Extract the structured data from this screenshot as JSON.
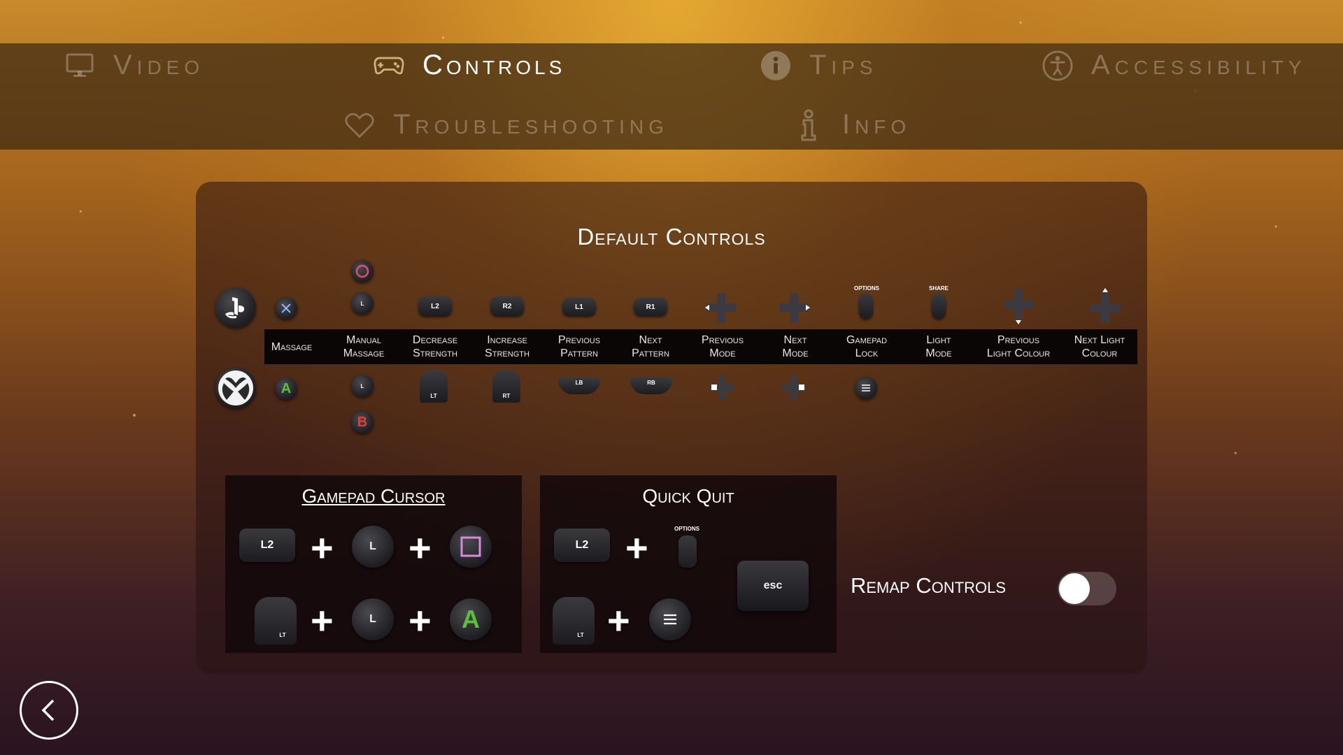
{
  "tabs": [
    {
      "label": "Video",
      "icon": "monitor-icon",
      "active": false
    },
    {
      "label": "Controls",
      "icon": "gamepad-icon",
      "active": true
    },
    {
      "label": "Tips",
      "icon": "info-circle-icon",
      "active": false
    },
    {
      "label": "Accessibility",
      "icon": "accessibility-icon",
      "active": false
    },
    {
      "label": "Troubleshooting",
      "icon": "heart-icon",
      "active": false
    },
    {
      "label": "Info",
      "icon": "info-person-icon",
      "active": false
    }
  ],
  "panel": {
    "title": "Default Controls"
  },
  "columns": [
    {
      "label1": "Massage",
      "label2": ""
    },
    {
      "label1": "Manual",
      "label2": "Massage"
    },
    {
      "label1": "Decrease",
      "label2": "Strength"
    },
    {
      "label1": "Increase",
      "label2": "Strength"
    },
    {
      "label1": "Previous",
      "label2": "Pattern"
    },
    {
      "label1": "Next",
      "label2": "Pattern"
    },
    {
      "label1": "Previous",
      "label2": "Mode"
    },
    {
      "label1": "Next",
      "label2": "Mode"
    },
    {
      "label1": "Gamepad",
      "label2": "Lock"
    },
    {
      "label1": "Light",
      "label2": "Mode"
    },
    {
      "label1": "Previous",
      "label2": "Light Colour"
    },
    {
      "label1": "Next Light",
      "label2": "Colour"
    }
  ],
  "ps_buttons": {
    "l2": "L2",
    "r2": "R2",
    "l1": "L1",
    "r1": "R1",
    "stick": "L",
    "options": "OPTIONS",
    "share": "SHARE"
  },
  "xbox_buttons": {
    "a": "A",
    "b": "B",
    "lt": "LT",
    "rt": "RT",
    "lb": "LB",
    "rb": "RB",
    "stick": "L"
  },
  "gamepad_cursor": {
    "title": "Gamepad Cursor",
    "ps_l2": "L2",
    "stick": "L",
    "xbox_lt": "LT",
    "xbox_a": "A"
  },
  "quick_quit": {
    "title": "Quick Quit",
    "ps_l2": "L2",
    "options": "OPTIONS",
    "xbox_lt": "LT",
    "esc": "esc"
  },
  "remap": {
    "label": "Remap Controls",
    "enabled": false
  },
  "colors": {
    "accent": "#ffffff",
    "ps_circle": "#e0506a",
    "ps_square": "#d88ad8",
    "xbox_a": "#5bbf3a",
    "xbox_b": "#d94040"
  }
}
